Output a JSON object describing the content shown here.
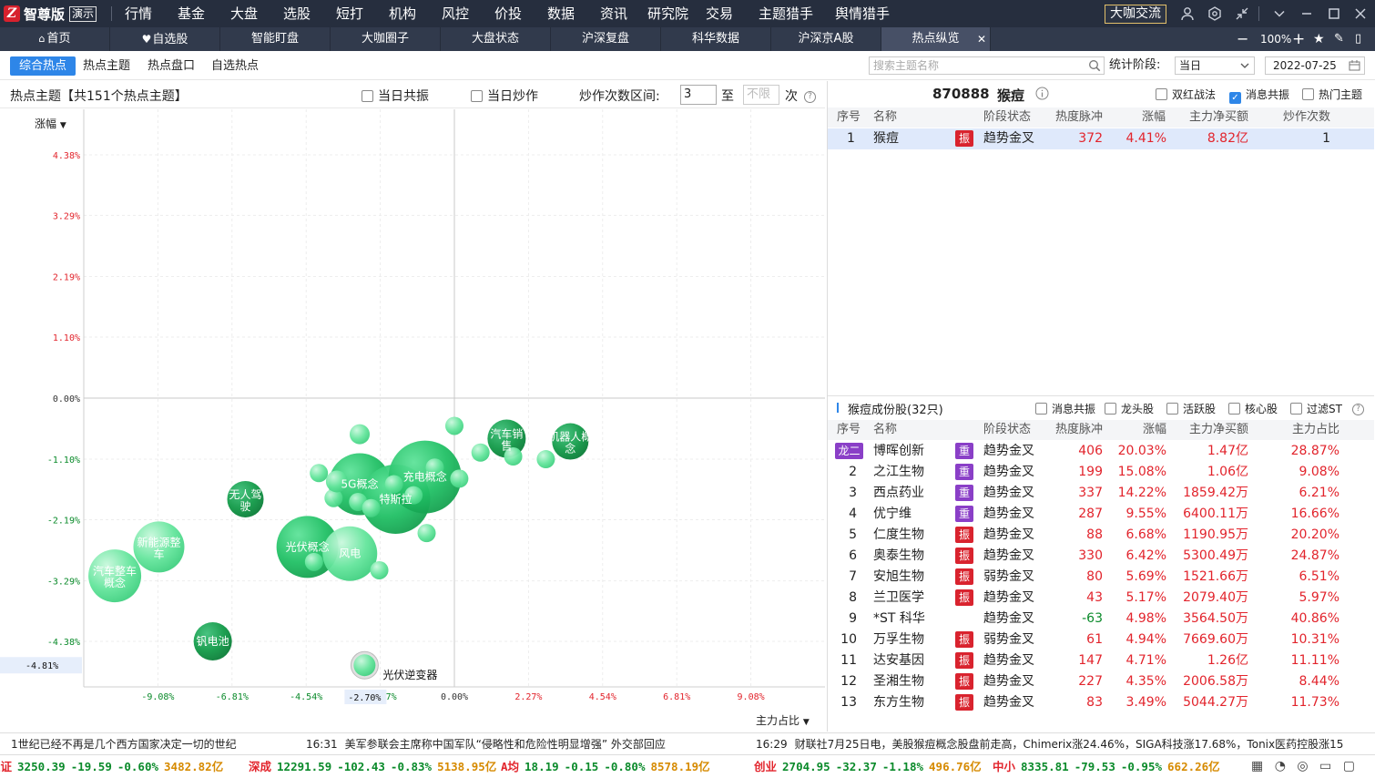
{
  "app": {
    "name": "智尊版",
    "demo_badge": "演示",
    "dk_button": "大咖交流"
  },
  "menu": [
    "行情",
    "基金",
    "大盘",
    "选股",
    "短打",
    "机构",
    "风控",
    "价投",
    "数据",
    "资讯",
    "研究院",
    "交易",
    "主题猎手",
    "舆情猎手"
  ],
  "titlebar_icons": [
    "user-icon",
    "settings-icon",
    "shrink-icon",
    "chevron-down-icon",
    "minimize-icon",
    "maximize-icon",
    "close-icon"
  ],
  "tabs": [
    "首页",
    "自选股",
    "智能盯盘",
    "大咖圈子",
    "大盘状态",
    "沪深复盘",
    "科华数据",
    "沪深京A股",
    "热点纵览"
  ],
  "tabbar_tools": {
    "zoom": "100%"
  },
  "subtabs": [
    "综合热点",
    "热点主题",
    "热点盘口",
    "自选热点"
  ],
  "search": {
    "placeholder": "搜索主题名称"
  },
  "stat": {
    "label": "统计阶段:",
    "period": "当日",
    "date": "2022-07-25"
  },
  "left": {
    "title": "热点主题【共151个热点主题】",
    "cb_resonance": "当日共振",
    "cb_hype": "当日炒作",
    "range_label": "炒作次数区间:",
    "range_from": "3",
    "range_to_label": "至",
    "range_to_placeholder": "不限",
    "range_unit": "次"
  },
  "chart_data": {
    "type": "scatter",
    "ylabel": "涨幅",
    "xlabel": "主力占比",
    "y_ticks": [
      "4.38%",
      "3.29%",
      "2.19%",
      "1.10%",
      "0.00%",
      "-1.10%",
      "-2.19%",
      "-3.29%",
      "-4.38%"
    ],
    "x_ticks": [
      "-9.08%",
      "-6.81%",
      "-4.54%",
      "-2.27%",
      "0.00%",
      "2.27%",
      "4.54%",
      "6.81%",
      "9.08%"
    ],
    "ylim": [
      -5.2,
      5.2
    ],
    "xlim": [
      -11.35,
      11.35
    ],
    "y_marker": "-4.81%",
    "x_marker": "-2.70%",
    "points": [
      {
        "label": "新能源整车",
        "x": -9.05,
        "y": -2.68,
        "r": 28
      },
      {
        "label": "汽车整车概念",
        "x": -10.4,
        "y": -3.2,
        "r": 29
      },
      {
        "label": "无人驾驶",
        "x": -6.4,
        "y": -1.82,
        "r": 20
      },
      {
        "label": "钒电池",
        "x": -7.4,
        "y": -4.38,
        "r": 21
      },
      {
        "label": "光伏概念",
        "x": -4.5,
        "y": -2.68,
        "r": 34
      },
      {
        "label": "5G概念",
        "x": -2.9,
        "y": -1.55,
        "r": 34
      },
      {
        "label": "特斯拉",
        "x": -1.8,
        "y": -1.82,
        "r": 38
      },
      {
        "label": "充电概念",
        "x": -0.9,
        "y": -1.42,
        "r": 40
      },
      {
        "label": "风电",
        "x": -3.2,
        "y": -2.8,
        "r": 30
      },
      {
        "label": "汽车销售",
        "x": 1.6,
        "y": -0.73,
        "r": 21
      },
      {
        "label": "机器人概念",
        "x": 3.55,
        "y": -0.78,
        "r": 20
      },
      {
        "label": "光伏逆变器",
        "x": -2.75,
        "y": -4.81,
        "r": 12
      },
      {
        "label": "",
        "x": -2.9,
        "y": -0.65,
        "r": 11
      },
      {
        "label": "",
        "x": 0.0,
        "y": -0.5,
        "r": 10
      },
      {
        "label": "",
        "x": 0.8,
        "y": -0.98,
        "r": 10
      },
      {
        "label": "",
        "x": 1.8,
        "y": -1.05,
        "r": 10
      },
      {
        "label": "",
        "x": 2.8,
        "y": -1.1,
        "r": 10
      },
      {
        "label": "",
        "x": -4.15,
        "y": -1.35,
        "r": 10
      },
      {
        "label": "",
        "x": -3.7,
        "y": -1.8,
        "r": 10
      },
      {
        "label": "",
        "x": -2.95,
        "y": -1.87,
        "r": 10
      },
      {
        "label": "",
        "x": -2.55,
        "y": -1.98,
        "r": 10
      },
      {
        "label": "",
        "x": -1.85,
        "y": -1.55,
        "r": 10
      },
      {
        "label": "",
        "x": -1.25,
        "y": -1.75,
        "r": 10
      },
      {
        "label": "",
        "x": -0.6,
        "y": -1.25,
        "r": 10
      },
      {
        "label": "",
        "x": 0.15,
        "y": -1.45,
        "r": 10
      },
      {
        "label": "",
        "x": -0.85,
        "y": -2.43,
        "r": 10
      },
      {
        "label": "",
        "x": -4.3,
        "y": -2.95,
        "r": 10
      },
      {
        "label": "",
        "x": -2.3,
        "y": -3.1,
        "r": 10
      },
      {
        "label": "",
        "x": -3.6,
        "y": -1.5,
        "r": 12
      }
    ]
  },
  "detail": {
    "code": "870888",
    "name": "猴痘",
    "filters": [
      {
        "label": "双红战法",
        "checked": false
      },
      {
        "label": "消息共振",
        "checked": true
      },
      {
        "label": "热门主题",
        "checked": false
      }
    ],
    "headers": [
      "序号",
      "名称",
      "阶段状态",
      "热度脉冲",
      "涨幅",
      "主力净买额",
      "炒作次数"
    ],
    "rows": [
      {
        "no": "1",
        "name": "猴痘",
        "tag": "振",
        "stage": "趋势金叉",
        "heat": "372",
        "chg": "4.41%",
        "net": "8.82亿",
        "times": "1"
      }
    ]
  },
  "stocks": {
    "title": "猴痘成份股(32只)",
    "filters": [
      "消息共振",
      "龙头股",
      "活跃股",
      "核心股",
      "过滤ST"
    ],
    "headers": [
      "序号",
      "名称",
      "阶段状态",
      "热度脉冲",
      "涨幅",
      "主力净买额",
      "主力占比"
    ],
    "rows": [
      {
        "no": "龙二",
        "name": "博晖创新",
        "tag": "重",
        "stage": "趋势金叉",
        "heat": "406",
        "chg": "20.03%",
        "net": "1.47亿",
        "ratio": "28.87%"
      },
      {
        "no": "2",
        "name": "之江生物",
        "tag": "重",
        "stage": "趋势金叉",
        "heat": "199",
        "chg": "15.08%",
        "net": "1.06亿",
        "ratio": "9.08%"
      },
      {
        "no": "3",
        "name": "西点药业",
        "tag": "重",
        "stage": "趋势金叉",
        "heat": "337",
        "chg": "14.22%",
        "net": "1859.42万",
        "ratio": "6.21%"
      },
      {
        "no": "4",
        "name": "优宁维",
        "tag": "重",
        "stage": "趋势金叉",
        "heat": "287",
        "chg": "9.55%",
        "net": "6400.11万",
        "ratio": "16.66%"
      },
      {
        "no": "5",
        "name": "仁度生物",
        "tag": "振",
        "stage": "趋势金叉",
        "heat": "88",
        "chg": "6.68%",
        "net": "1190.95万",
        "ratio": "20.20%"
      },
      {
        "no": "6",
        "name": "奥泰生物",
        "tag": "振",
        "stage": "趋势金叉",
        "heat": "330",
        "chg": "6.42%",
        "net": "5300.49万",
        "ratio": "24.87%"
      },
      {
        "no": "7",
        "name": "安旭生物",
        "tag": "振",
        "stage": "弱势金叉",
        "heat": "80",
        "chg": "5.69%",
        "net": "1521.66万",
        "ratio": "6.51%"
      },
      {
        "no": "8",
        "name": "兰卫医学",
        "tag": "振",
        "stage": "趋势金叉",
        "heat": "43",
        "chg": "5.17%",
        "net": "2079.40万",
        "ratio": "5.97%"
      },
      {
        "no": "9",
        "name": "*ST 科华",
        "tag": "",
        "stage": "趋势金叉",
        "heat": "-63",
        "chg": "4.98%",
        "net": "3564.50万",
        "ratio": "40.86%"
      },
      {
        "no": "10",
        "name": "万孚生物",
        "tag": "振",
        "stage": "弱势金叉",
        "heat": "61",
        "chg": "4.94%",
        "net": "7669.60万",
        "ratio": "10.31%"
      },
      {
        "no": "11",
        "name": "达安基因",
        "tag": "振",
        "stage": "趋势金叉",
        "heat": "147",
        "chg": "4.71%",
        "net": "1.26亿",
        "ratio": "11.11%"
      },
      {
        "no": "12",
        "name": "圣湘生物",
        "tag": "振",
        "stage": "趋势金叉",
        "heat": "227",
        "chg": "4.35%",
        "net": "2006.58万",
        "ratio": "8.44%"
      },
      {
        "no": "13",
        "name": "东方生物",
        "tag": "振",
        "stage": "趋势金叉",
        "heat": "83",
        "chg": "3.49%",
        "net": "5044.27万",
        "ratio": "11.73%"
      }
    ]
  },
  "news": [
    {
      "time": "",
      "text": "1世纪已经不再是几个西方国家决定一切的世纪"
    },
    {
      "time": "16:31",
      "text": "美军参联会主席称中国军队“侵略性和危险性明显增强” 外交部回应"
    },
    {
      "time": "16:29",
      "text": "财联社7月25日电，美股猴痘概念股盘前走高，Chimerix涨24.46%，SIGA科技涨17.68%，Tonix医药控股涨15"
    }
  ],
  "ticker": [
    {
      "name": "上证",
      "last": "3250.39",
      "chg": "-19.59",
      "pct": "-0.60%",
      "amt": "3482.82亿"
    },
    {
      "name": "深成",
      "last": "12291.59",
      "chg": "-102.43",
      "pct": "-0.83%",
      "amt": "5138.95亿"
    },
    {
      "name": "A均",
      "last": "18.19",
      "chg": "-0.15",
      "pct": "-0.80%",
      "amt": "8578.19亿"
    },
    {
      "name": "创业",
      "last": "2704.95",
      "chg": "-32.37",
      "pct": "-1.18%",
      "amt": "496.76亿"
    },
    {
      "name": "中小",
      "last": "8335.81",
      "chg": "-79.53",
      "pct": "-0.95%",
      "amt": "662.26亿"
    }
  ]
}
